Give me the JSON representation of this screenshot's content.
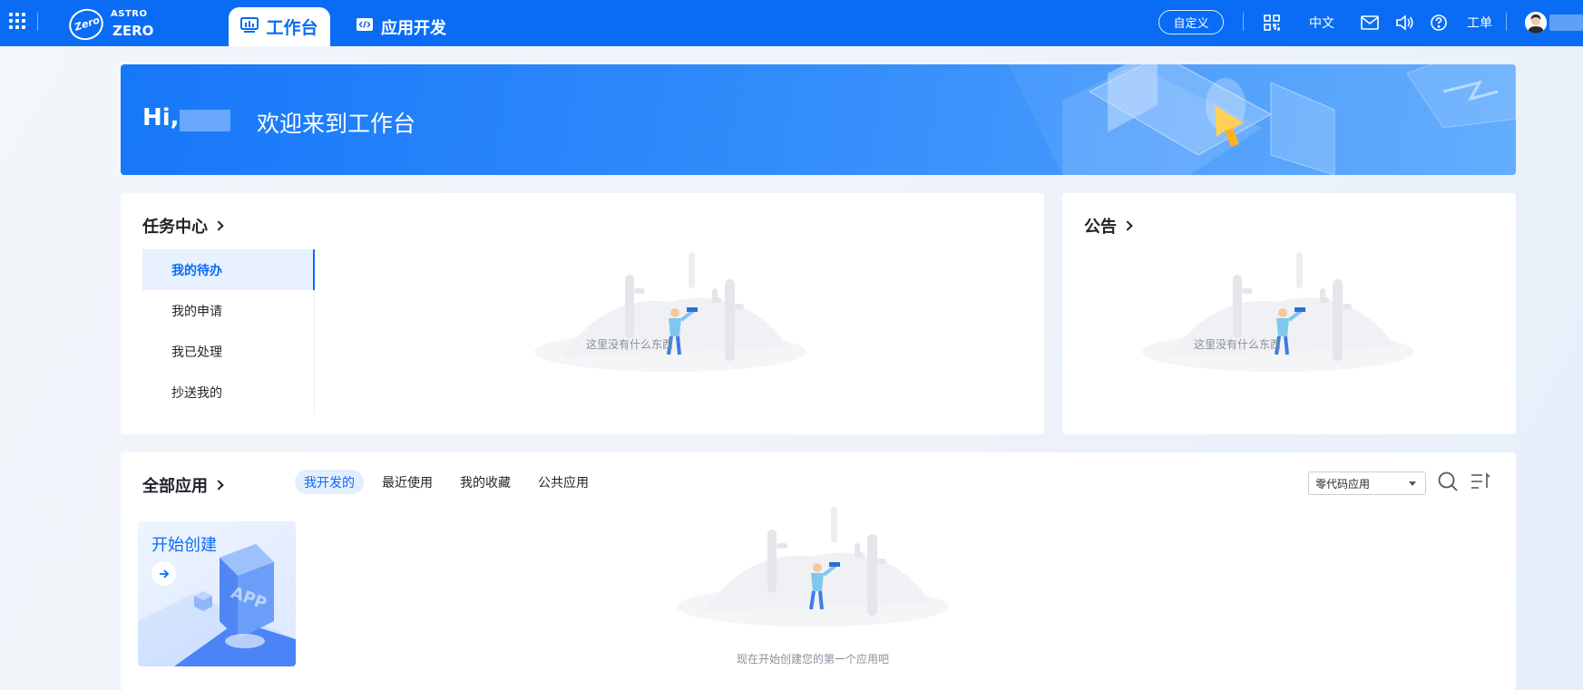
{
  "topbar": {
    "logo_top": "ASTRO",
    "logo_bottom": "ZERO",
    "logo_badge": "Zero",
    "tabs": [
      {
        "label": "工作台",
        "icon": "monitor-icon",
        "active": true
      },
      {
        "label": "应用开发",
        "icon": "code-icon",
        "active": false
      }
    ],
    "customize_label": "自定义",
    "language_label": "中文",
    "ticket_label": "工单",
    "icons": [
      "apps-grid-icon",
      "qrcode-icon",
      "mail-icon",
      "speaker-icon",
      "help-icon",
      "avatar"
    ]
  },
  "banner": {
    "greeting": "Hi,",
    "welcome": "欢迎来到工作台"
  },
  "task_center": {
    "title": "任务中心",
    "items": [
      {
        "label": "我的待办",
        "active": true
      },
      {
        "label": "我的申请",
        "active": false
      },
      {
        "label": "我已处理",
        "active": false
      },
      {
        "label": "抄送我的",
        "active": false
      }
    ],
    "empty_text": "这里没有什么东西"
  },
  "announcement": {
    "title": "公告",
    "empty_text": "这里没有什么东西"
  },
  "all_apps": {
    "title": "全部应用",
    "tabs": [
      {
        "label": "我开发的",
        "active": true
      },
      {
        "label": "最近使用",
        "active": false
      },
      {
        "label": "我的收藏",
        "active": false
      },
      {
        "label": "公共应用",
        "active": false
      }
    ],
    "filter_value": "零代码应用",
    "create_label": "开始创建",
    "create_art_text": "APP",
    "empty_text": "现在开始创建您的第一个应用吧"
  },
  "colors": {
    "brand": "#0a6cf5",
    "active_bg": "#e8f1ff",
    "muted_text": "#8a8f99"
  }
}
